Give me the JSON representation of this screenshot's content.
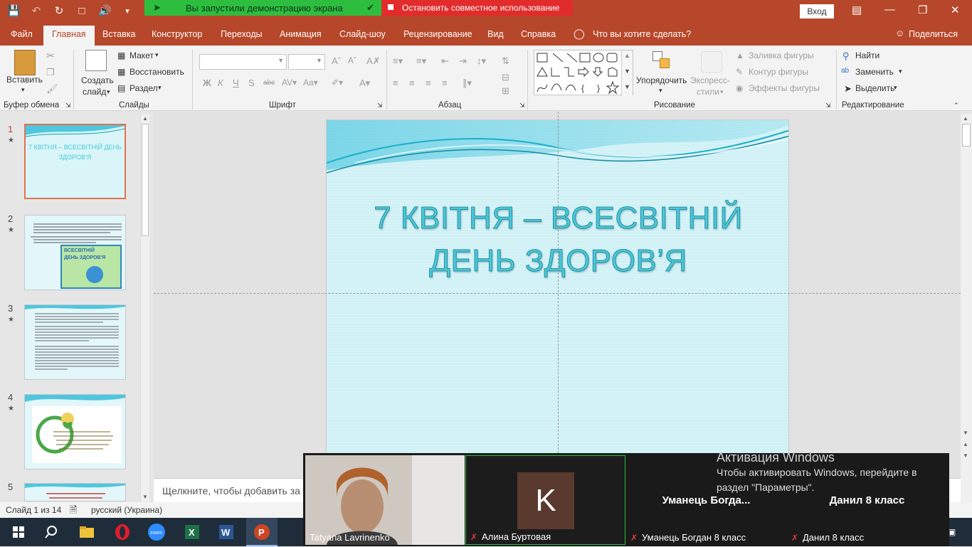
{
  "titlebar": {
    "sharing_banner": "Вы запустили демонстрацию экрана",
    "stop_sharing": "Остановить совместное использование",
    "signin": "Вход"
  },
  "tabs": [
    "Файл",
    "Главная",
    "Вставка",
    "Конструктор",
    "Переходы",
    "Анимация",
    "Слайд-шоу",
    "Рецензирование",
    "Вид",
    "Справка"
  ],
  "tell_me": "Что вы хотите сделать?",
  "share_label": "Поделиться",
  "ribbon": {
    "paste": "Вставить",
    "clipboard_group": "Буфер обмена",
    "new_slide_1": "Создать",
    "new_slide_2": "слайд",
    "layout": "Макет",
    "reset": "Восстановить",
    "section": "Раздел",
    "slides_group": "Слайды",
    "font_group": "Шрифт",
    "paragraph_group": "Абзац",
    "arrange": "Упорядочить",
    "quick_styles_1": "Экспресс-",
    "quick_styles_2": "стили",
    "shape_fill": "Заливка фигуры",
    "shape_outline": "Контур фигуры",
    "shape_effects": "Эффекты фигуры",
    "drawing_group": "Рисование",
    "find": "Найти",
    "replace": "Заменить",
    "select": "Выделить",
    "editing_group": "Редактирование"
  },
  "slides": [
    {
      "num": "1",
      "star": "★",
      "title": "7 КВІТНЯ – ВСЕСВІТНІЙ ДЕНЬ ЗДОРОВ’Я"
    },
    {
      "num": "2",
      "star": "★",
      "badge1": "ВСЕСВІТНІЙ",
      "badge2": "ДЕНЬ ЗДОРОВ'Я"
    },
    {
      "num": "3",
      "star": "★"
    },
    {
      "num": "4",
      "star": "★"
    },
    {
      "num": "5",
      "star": ""
    }
  ],
  "main_slide": {
    "title_line1": "7 КВІТНЯ – ВСЕСВІТНІЙ",
    "title_line2": "ДЕНЬ ЗДОРОВ’Я"
  },
  "notes_placeholder": "Щелкните, чтобы добавить за",
  "status": {
    "slide_counter": "Слайд 1 из 14",
    "language": "русский (Украина)"
  },
  "zoom": {
    "participants": [
      {
        "name": "Tatyana Lavrinenko",
        "muted": false
      },
      {
        "name": "Алина Буртовая",
        "initial": "K",
        "muted": true
      },
      {
        "name": "Уманець Богдан 8 класс",
        "header": "Уманець  Богда...",
        "muted": true
      },
      {
        "name": "Данил 8 класс",
        "header": "Данил 8 класс",
        "muted": true
      }
    ]
  },
  "activation": {
    "title": "Активация Windows",
    "line1": "Чтобы активировать Windows, перейдите в",
    "line2": "раздел \"Параметры\"."
  },
  "colors": {
    "accent": "#b7472a",
    "sharing_green": "#2dbe3f",
    "sharing_red": "#e22b2b",
    "slide_title": "#49c8d9",
    "slide_bg": "#d6f3f7"
  }
}
